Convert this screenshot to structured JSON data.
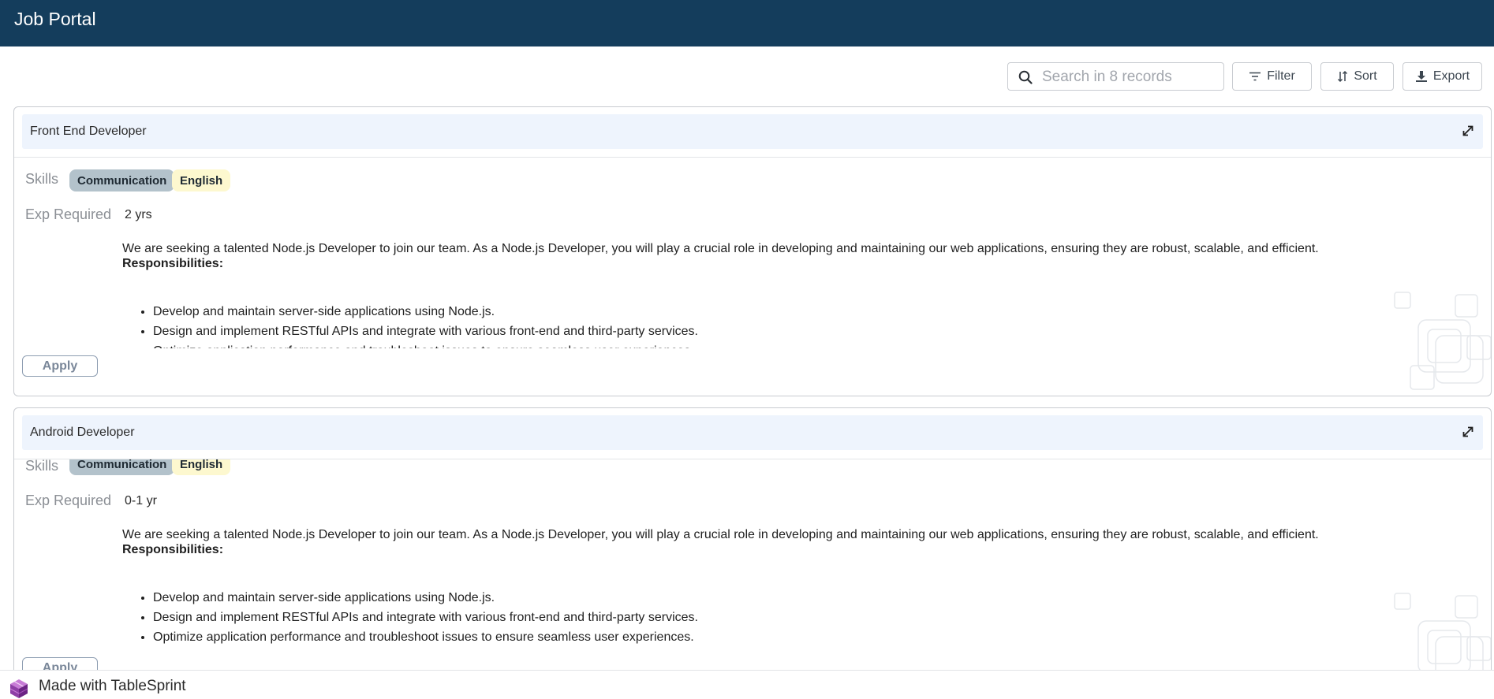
{
  "header": {
    "title": "Job Portal"
  },
  "toolbar": {
    "search_placeholder": "Search in 8 records",
    "filter_label": "Filter",
    "sort_label": "Sort",
    "export_label": "Export"
  },
  "labels": {
    "skills": "Skills",
    "exp_required": "Exp Required",
    "responsibilities": "Responsibilities:",
    "apply": "Apply"
  },
  "jobs": [
    {
      "title": "Front End Developer",
      "skills": [
        "Communication",
        "English"
      ],
      "experience": "2 yrs",
      "description": "We are seeking a talented Node.js Developer to join our team. As a Node.js Developer, you will play a crucial role in developing and maintaining our web applications, ensuring they are robust, scalable, and efficient.",
      "responsibilities": [
        "Develop and maintain server-side applications using Node.js.",
        "Design and implement RESTful APIs and integrate with various front-end and third-party services.",
        "Optimize application performance and troubleshoot issues to ensure seamless user experiences."
      ]
    },
    {
      "title": "Android Developer",
      "skills": [
        "Communication",
        "English"
      ],
      "experience": "0-1 yr",
      "description": "We are seeking a talented Node.js Developer to join our team. As a Node.js Developer, you will play a crucial role in developing and maintaining our web applications, ensuring they are robust, scalable, and efficient.",
      "responsibilities": [
        "Develop and maintain server-side applications using Node.js.",
        "Design and implement RESTful APIs and integrate with various front-end and third-party services.",
        "Optimize application performance and troubleshoot issues to ensure seamless user experiences."
      ]
    }
  ],
  "footer": {
    "made_with": "Made with TableSprint"
  },
  "colors": {
    "header_bg": "#143d5c",
    "card_head_bg": "#eef4fd",
    "chip_communication": "#b3c2cb",
    "chip_english": "#fdf8cf"
  }
}
